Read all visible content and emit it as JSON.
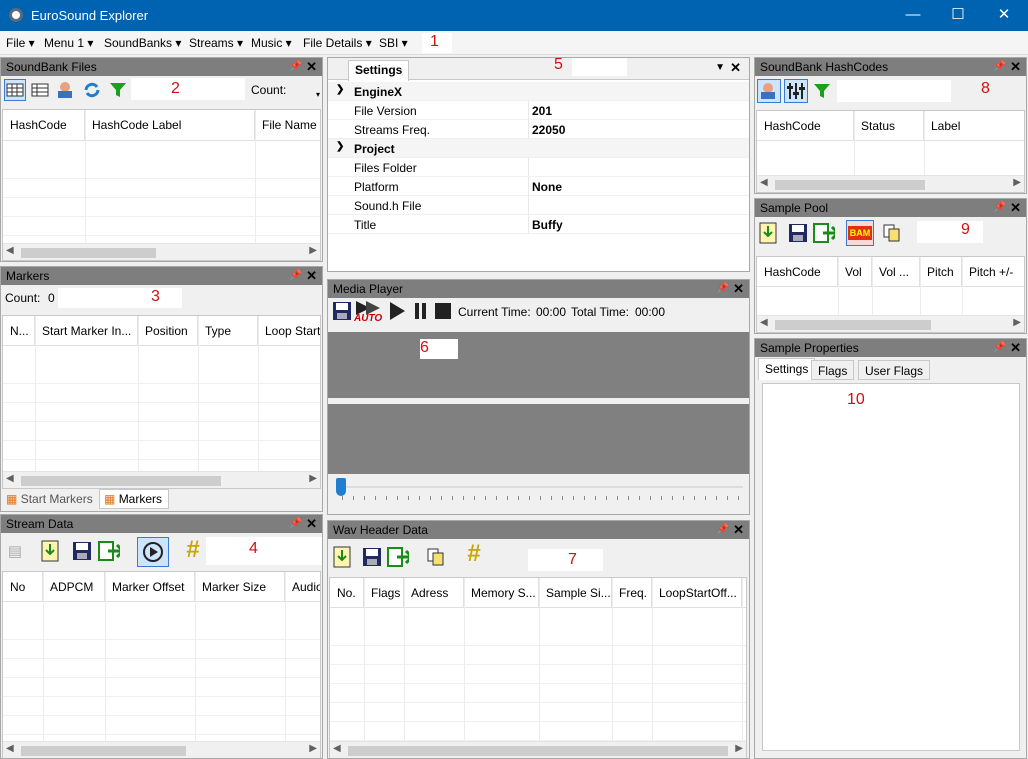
{
  "window": {
    "title": "EuroSound Explorer",
    "minimize": "—",
    "maximize": "☐",
    "close": "✕"
  },
  "menu": [
    "File",
    "Menu 1",
    "SoundBanks",
    "Streams",
    "Music",
    "File Details",
    "SBI"
  ],
  "markers_num": {
    "n1": "1",
    "n2": "2",
    "n3": "3",
    "n4": "4",
    "n5": "5",
    "n6": "6",
    "n7": "7",
    "n8": "8",
    "n9": "9",
    "n10": "10"
  },
  "soundbank_files": {
    "title": "SoundBank Files",
    "count_label": "Count:",
    "columns": [
      "HashCode",
      "HashCode Label",
      "File Name"
    ]
  },
  "markers": {
    "title": "Markers",
    "count_label": "Count:",
    "count_value": "0",
    "columns": [
      "N...",
      "Start Marker In...",
      "Position",
      "Type",
      "Loop Start"
    ],
    "tabs": [
      "Start Markers",
      "Markers"
    ]
  },
  "stream_data": {
    "title": "Stream Data",
    "columns": [
      "No",
      "ADPCM",
      "Marker Offset",
      "Marker Size",
      "Audio"
    ]
  },
  "settings": {
    "tab": "Settings",
    "categories": [
      {
        "name": "EngineX",
        "rows": [
          {
            "key": "File Version",
            "value": "201"
          },
          {
            "key": "Streams Freq.",
            "value": "22050"
          }
        ]
      },
      {
        "name": "Project",
        "rows": [
          {
            "key": "Files Folder",
            "value": ""
          },
          {
            "key": "Platform",
            "value": "None"
          },
          {
            "key": "Sound.h File",
            "value": ""
          },
          {
            "key": "Title",
            "value": "Buffy"
          }
        ]
      }
    ]
  },
  "media_player": {
    "title": "Media Player",
    "auto_label": "AUTO",
    "current_time_label": "Current Time:",
    "current_time": "00:00",
    "total_time_label": "Total Time:",
    "total_time": "00:00"
  },
  "wav_header": {
    "title": "Wav Header Data",
    "columns": [
      "No.",
      "Flags",
      "Adress",
      "Memory S...",
      "Sample Si...",
      "Freq.",
      "LoopStartOff..."
    ]
  },
  "hashcodes": {
    "title": "SoundBank HashCodes",
    "columns": [
      "HashCode",
      "Status",
      "Label"
    ]
  },
  "sample_pool": {
    "title": "Sample Pool",
    "bam_label": "BAM",
    "columns": [
      "HashCode",
      "Vol",
      "Vol ...",
      "Pitch",
      "Pitch +/-"
    ]
  },
  "sample_properties": {
    "title": "Sample Properties",
    "tabs": [
      "Settings",
      "Flags",
      "User Flags"
    ]
  },
  "colors": {
    "titlebar": "#0063b1",
    "panel_header": "#7e7e7e",
    "annotation": "#d01010"
  }
}
